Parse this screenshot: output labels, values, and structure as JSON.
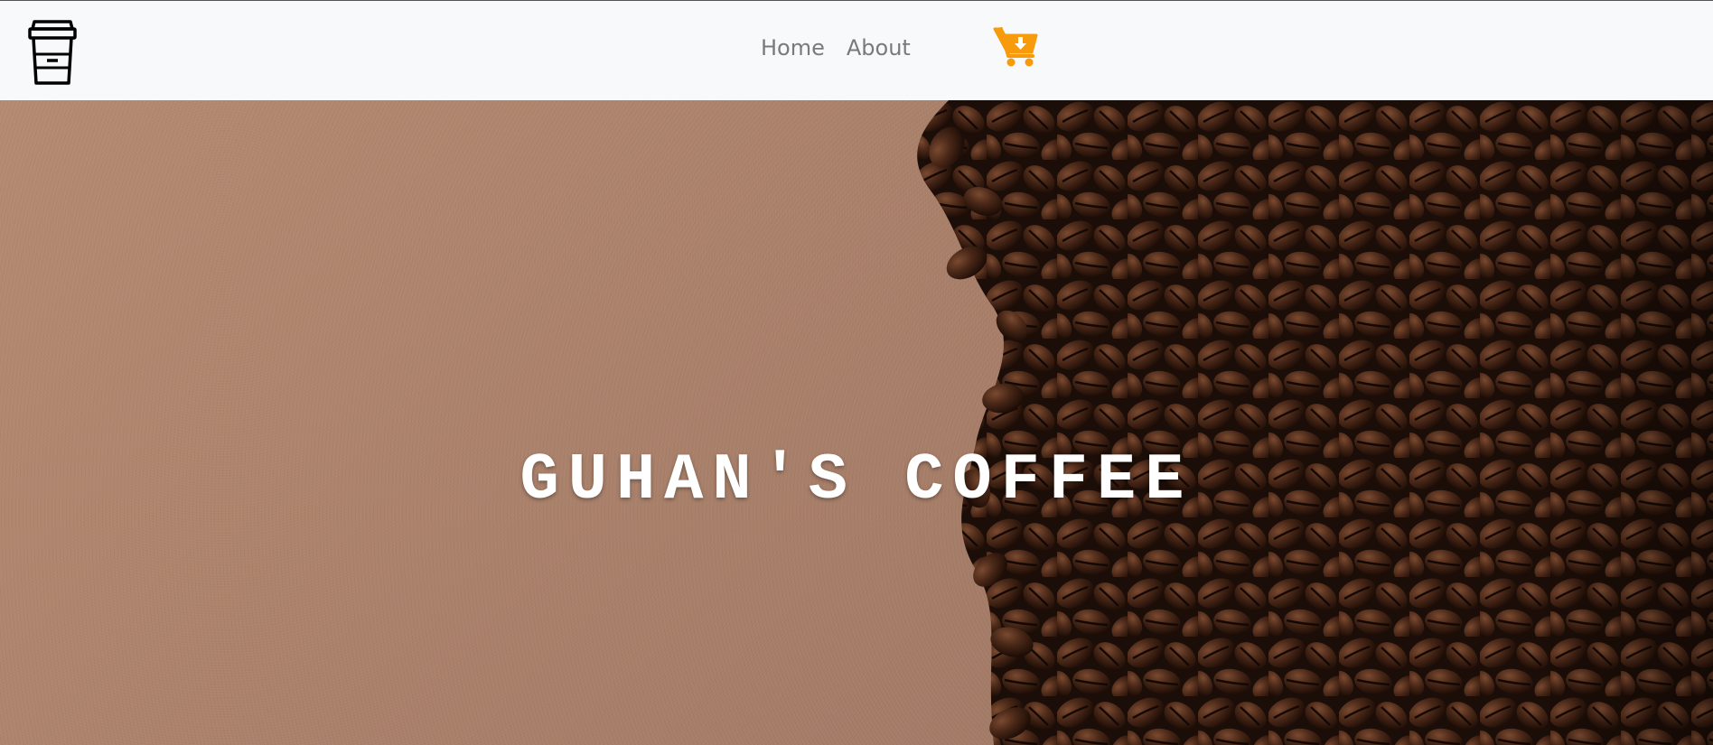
{
  "navbar": {
    "logo_icon": "coffee-cup-icon",
    "links": [
      {
        "label": "Home"
      },
      {
        "label": "About"
      }
    ],
    "cart_icon": "cart-download-icon",
    "cart_color": "#f79a0b",
    "background": "#f8f9fa"
  },
  "hero": {
    "title": "GUHAN'S COFFEE",
    "background_image": "coffee-beans-on-brown-paper"
  }
}
